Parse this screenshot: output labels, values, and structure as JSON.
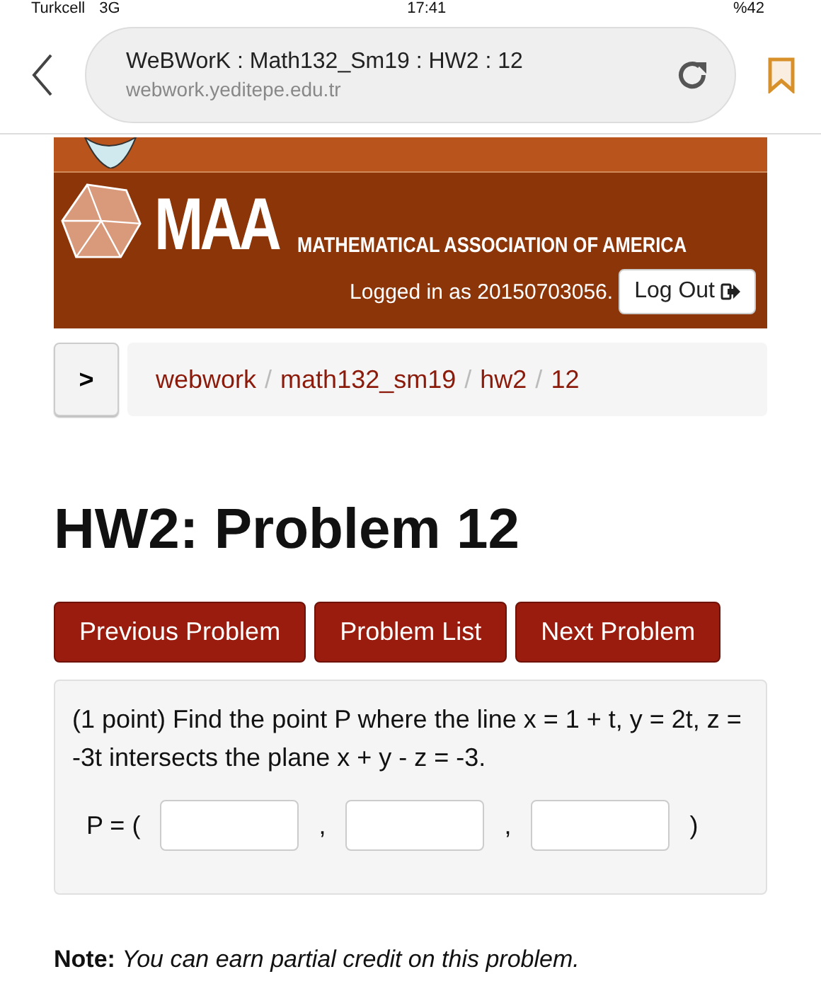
{
  "status_bar": {
    "carrier": "Turkcell",
    "network": "3G",
    "time": "17:41",
    "battery": "%42"
  },
  "browser": {
    "page_title": "WeBWorK : Math132_Sm19 : HW2 : 12",
    "url": "webwork.yeditepe.edu.tr",
    "bookmarked": true
  },
  "banner": {
    "logo_text": "MAA",
    "organization": "MATHEMATICAL ASSOCIATION OF AMERICA",
    "login_text": "Logged in as 20150703056.",
    "logout_button": "Log Out"
  },
  "breadcrumb": {
    "toggle": ">",
    "items": [
      "webwork",
      "math132_sm19",
      "hw2",
      "12"
    ],
    "separator": "/"
  },
  "title": "HW2: Problem 12",
  "nav_buttons": [
    "Previous Problem",
    "Problem List",
    "Next Problem"
  ],
  "problem": {
    "statement": "(1 point) Find the point P where the line x = 1 + t, y = 2t, z = -3t intersects the plane x + y - z = -3.",
    "answer_label": "P = (",
    "separators": [
      ",",
      ","
    ],
    "closing": ")",
    "answers": [
      {
        "kind": "input"
      },
      {
        "kind": "input"
      },
      {
        "kind": "input"
      }
    ]
  },
  "note": {
    "label": "Note:",
    "text": "You can earn partial credit on this problem."
  }
}
